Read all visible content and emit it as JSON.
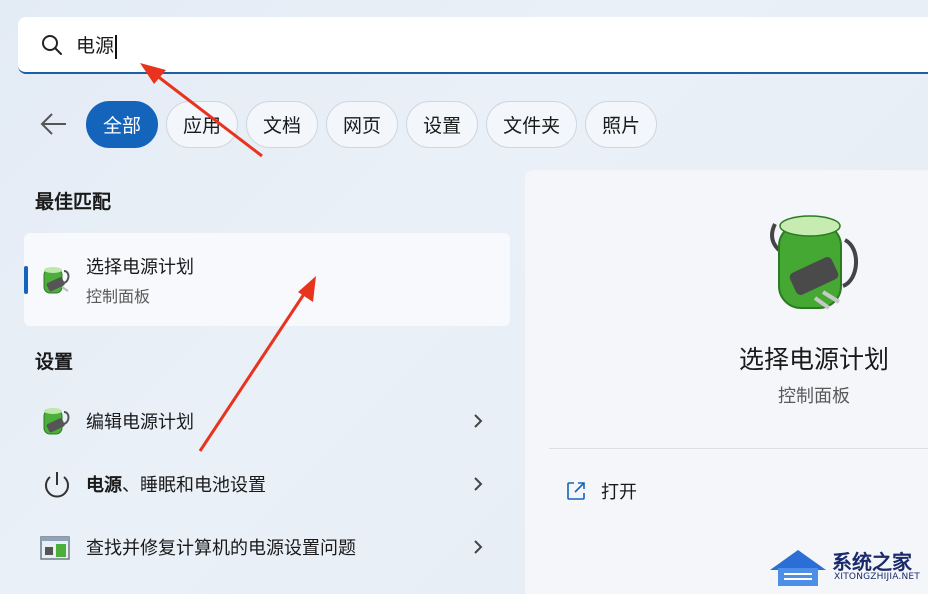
{
  "search": {
    "value": "电源"
  },
  "filters": [
    "全部",
    "应用",
    "文档",
    "网页",
    "设置",
    "文件夹",
    "照片"
  ],
  "best_match": {
    "heading": "最佳匹配",
    "title": "选择电源计划",
    "subtitle": "控制面板"
  },
  "settings_section": {
    "heading": "设置",
    "items": [
      {
        "label": "编辑电源计划"
      },
      {
        "label_bold": "电源",
        "label_rest": "、睡眠和电池设置"
      },
      {
        "label": "查找并修复计算机的电源设置问题"
      }
    ]
  },
  "detail": {
    "title": "选择电源计划",
    "subtitle": "控制面板",
    "open_label": "打开"
  },
  "watermark": {
    "name": "系统之家",
    "url": "XITONGZHIJIA.NET"
  },
  "colors": {
    "accent": "#1464bb",
    "annotation_arrow": "#e8331e"
  }
}
